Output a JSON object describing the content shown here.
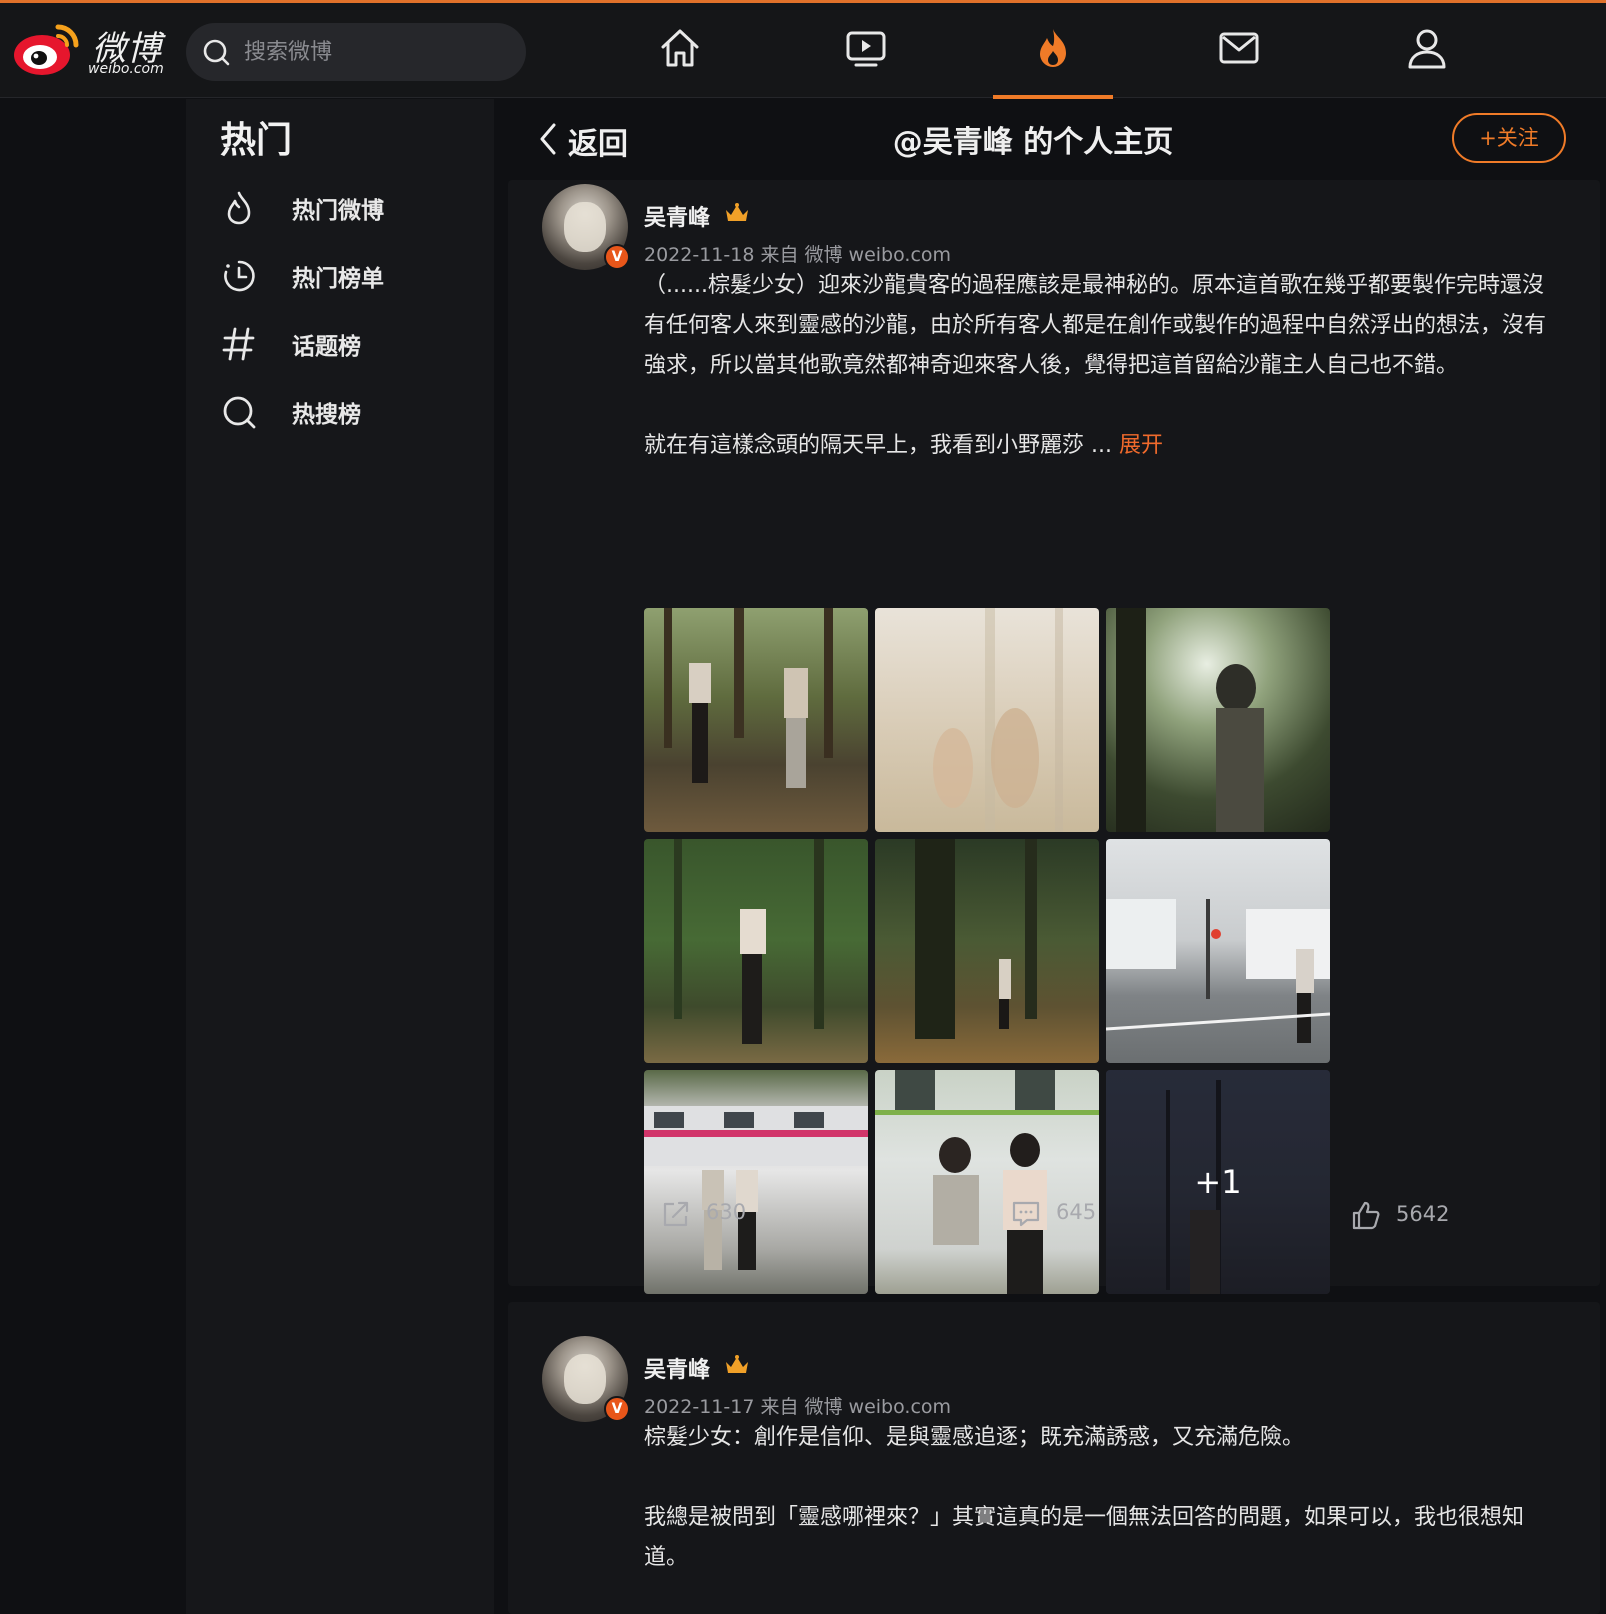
{
  "brand": {
    "logo_text": "微博",
    "logo_sub": "weibo.com"
  },
  "search": {
    "placeholder": "搜索微博"
  },
  "topnav": {
    "items": [
      {
        "name": "home",
        "icon": "home-icon"
      },
      {
        "name": "video",
        "icon": "tv-icon"
      },
      {
        "name": "hot",
        "icon": "flame-icon",
        "active": true
      },
      {
        "name": "messages",
        "icon": "mail-icon"
      },
      {
        "name": "profile",
        "icon": "user-icon"
      }
    ],
    "accent_color": "#f07b28"
  },
  "sidebar": {
    "title": "热门",
    "items": [
      {
        "label": "热门微博",
        "icon": "flame-outline-icon"
      },
      {
        "label": "热门榜单",
        "icon": "clock-chart-icon"
      },
      {
        "label": "话题榜",
        "icon": "hashtag-icon"
      },
      {
        "label": "热搜榜",
        "icon": "search-ring-icon"
      }
    ]
  },
  "header": {
    "back_label": "返回",
    "title": "@吴青峰 的个人主页",
    "follow_label": "+关注"
  },
  "posts": [
    {
      "author": "吴青峰",
      "verified": true,
      "date": "2022-11-18",
      "source": "来自 微博 weibo.com",
      "paragraphs": [
        "（......棕髮少女）迎來沙龍貴客的過程應該是最神秘的。原本這首歌在幾乎都要製作完時還沒有任何客人來到靈感的沙龍，由於所有客人都是在創作或製作的過程中自然浮出的想法，沒有強求，所以當其他歌竟然都神奇迎來客人後，覺得把這首留給沙龍主人自己也不錯。",
        "就在有這樣念頭的隔天早上，我看到小野麗莎 ..."
      ],
      "expand_label": "展开",
      "image_count_extra": "+1",
      "images": 9,
      "reposts": "630",
      "comments": "645",
      "likes": "5642"
    },
    {
      "author": "吴青峰",
      "verified": true,
      "date": "2022-11-17",
      "source": "来自 微博 weibo.com",
      "paragraphs": [
        "棕髮少女：創作是信仰、是與靈感追逐；既充滿誘惑，又充滿危險。",
        "我總是被問到「靈感哪裡來？」其實這真的是一個無法回答的問題，如果可以，我也很想知道。"
      ]
    }
  ]
}
